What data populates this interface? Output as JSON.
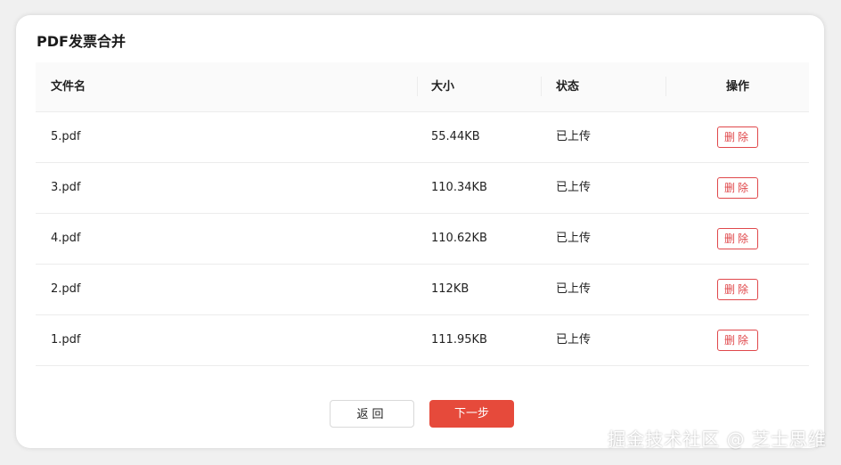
{
  "dialog": {
    "title": "PDF发票合并"
  },
  "table": {
    "headers": {
      "file_name": "文件名",
      "size": "大小",
      "status": "状态",
      "actions": "操作"
    },
    "rows": [
      {
        "file_name": "5.pdf",
        "size": "55.44KB",
        "status": "已上传",
        "action_label": "删除"
      },
      {
        "file_name": "3.pdf",
        "size": "110.34KB",
        "status": "已上传",
        "action_label": "删除"
      },
      {
        "file_name": "4.pdf",
        "size": "110.62KB",
        "status": "已上传",
        "action_label": "删除"
      },
      {
        "file_name": "2.pdf",
        "size": "112KB",
        "status": "已上传",
        "action_label": "删除"
      },
      {
        "file_name": "1.pdf",
        "size": "111.95KB",
        "status": "已上传",
        "action_label": "删除"
      }
    ]
  },
  "footer": {
    "back_label": "返回",
    "next_label": "下一步"
  },
  "watermark": "掘金技术社区 @ 芝士思维",
  "colors": {
    "accent": "#e64a3b",
    "danger": "#e0484b",
    "header_bg": "#fafafa"
  }
}
